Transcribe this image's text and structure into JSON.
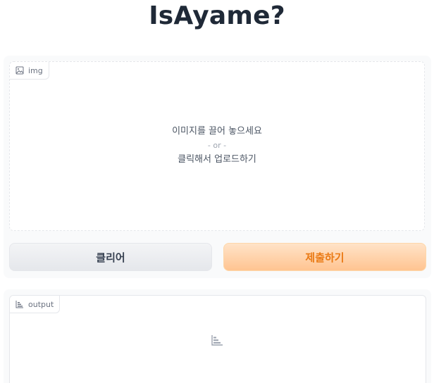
{
  "page": {
    "title": "IsAyame?"
  },
  "input_panel": {
    "label": "img",
    "label_icon": "image-icon",
    "drop_line1": "이미지를 끌어 놓으세요",
    "drop_or": "- or -",
    "drop_line2": "클릭해서 업로드하기"
  },
  "buttons": {
    "clear_label": "클리어",
    "submit_label": "제출하기"
  },
  "output_panel": {
    "label": "output",
    "label_icon": "bar-chart-icon",
    "placeholder_icon": "bar-chart-icon"
  },
  "colors": {
    "submit_text": "#ea7a14",
    "submit_bg": "#ffc491",
    "clear_bg": "#e5e7eb"
  }
}
